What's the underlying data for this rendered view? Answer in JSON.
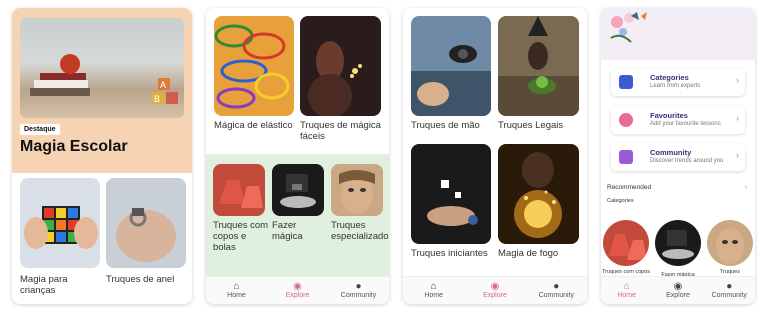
{
  "screen1": {
    "badge": "Destaque",
    "hero_title": "Magia Escolar",
    "cards": [
      {
        "label": "Magia para crianças"
      },
      {
        "label": "Truques de anel"
      }
    ]
  },
  "screen2": {
    "cards": [
      {
        "label": "Mágica de elástico"
      },
      {
        "label": "Truques de mágica fáceis"
      },
      {
        "label": "Truques com copos e bolas"
      },
      {
        "label": "Fazer mágica"
      },
      {
        "label": "Truques especializados"
      }
    ]
  },
  "screen3": {
    "cards": [
      {
        "label": "Truques de mão"
      },
      {
        "label": "Truques Legais"
      },
      {
        "label": "Truques iniciantes"
      },
      {
        "label": "Magia de fogo"
      }
    ]
  },
  "screen4": {
    "menu": [
      {
        "title": "Categories",
        "subtitle": "Learn from experts"
      },
      {
        "title": "Favourites",
        "subtitle": "Add your favourite lessons"
      },
      {
        "title": "Community",
        "subtitle": "Discover trends around you"
      }
    ],
    "recommended": "Recommended",
    "categories": "Categories",
    "circles": [
      {
        "label": "Truques com copos e bolas"
      },
      {
        "label": "Fazer mágica"
      },
      {
        "label": "Truques especializados"
      }
    ]
  },
  "nav": {
    "home": "Home",
    "explore": "Explore",
    "community": "Community"
  },
  "colors": {
    "accent": "#d86a8a",
    "hero_bg": "#f6d3b3",
    "green_bg": "#dff0df",
    "menu_title": "#3a2f7a"
  }
}
